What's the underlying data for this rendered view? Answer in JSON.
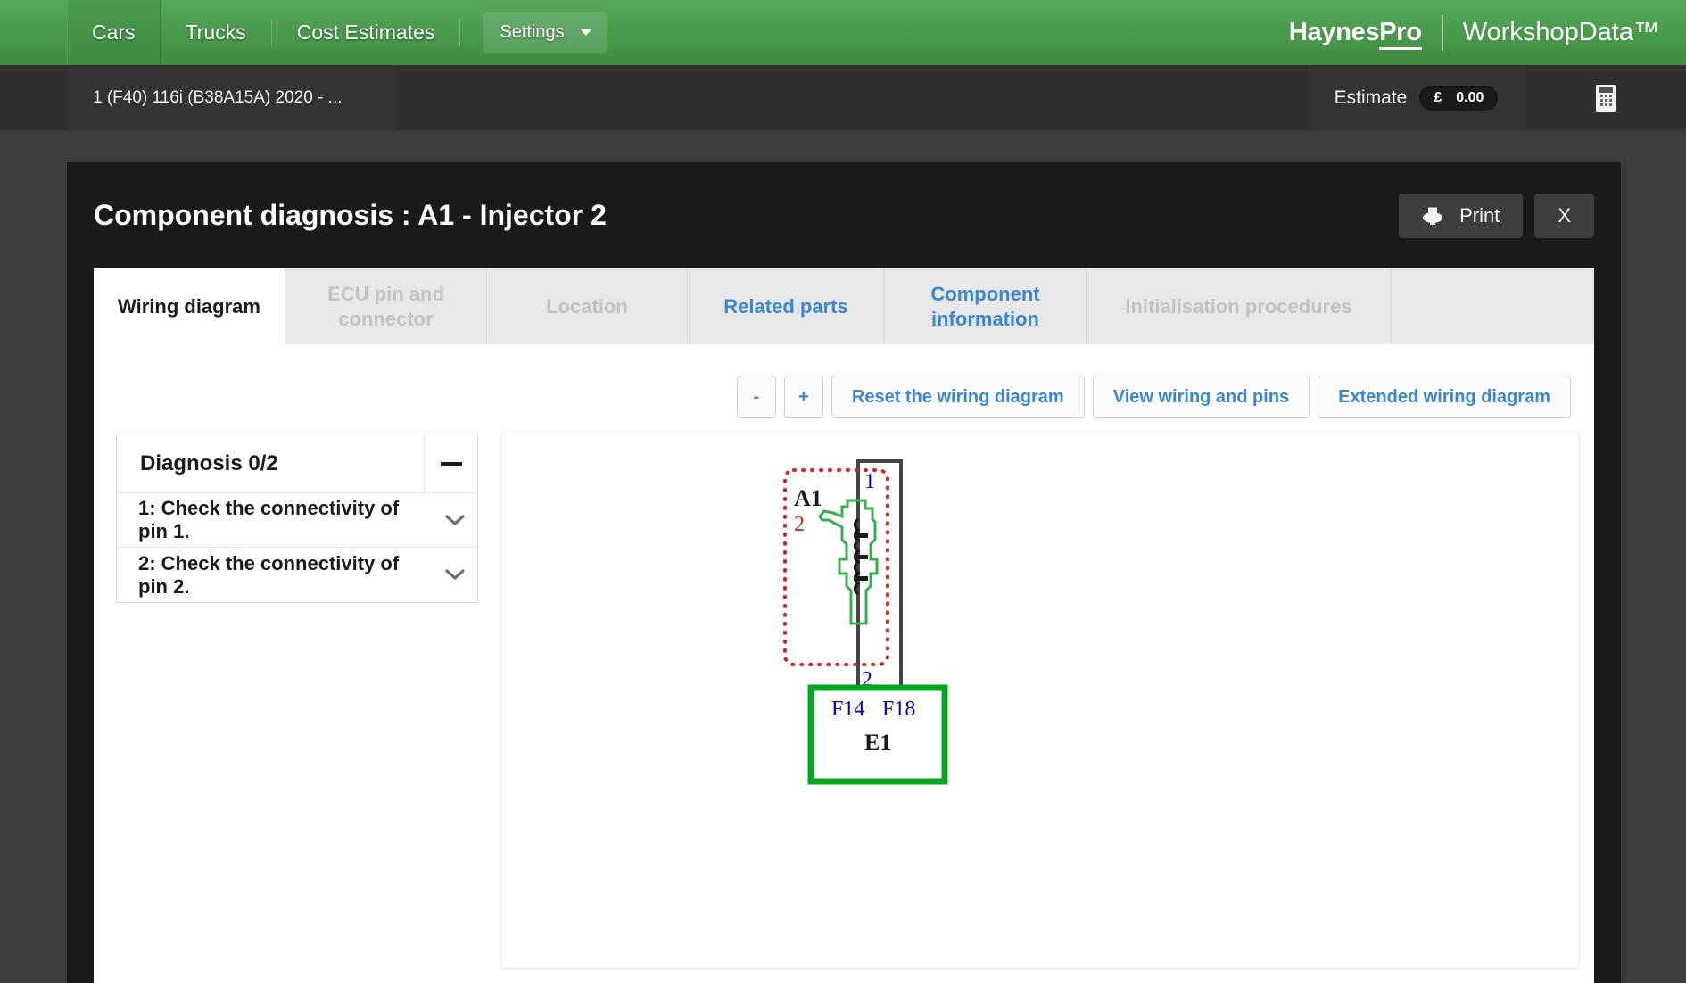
{
  "topnav": {
    "items": [
      {
        "label": "Cars",
        "active": true
      },
      {
        "label": "Trucks",
        "active": false
      },
      {
        "label": "Cost Estimates",
        "active": false
      }
    ],
    "settings_label": "Settings",
    "brand_primary": "HaynesPro",
    "brand_primary_part1": "Haynes",
    "brand_primary_part2": "Pro",
    "brand_secondary": "WorkshopData™",
    "accent_green": "#4a9a4c"
  },
  "vehicle_bar": {
    "vehicle": "1 (F40) 116i (B38A15A) 2020 - ...",
    "estimate_label": "Estimate",
    "estimate_currency": "£",
    "estimate_value": "0.00",
    "calculator_icon": "calculator-icon"
  },
  "panel": {
    "title": "Component diagnosis : A1 - Injector 2",
    "print_label": "Print",
    "close_label": "X"
  },
  "tabs": [
    {
      "label": "Wiring diagram",
      "state": "active"
    },
    {
      "label": "ECU pin and connector",
      "state": "disabled"
    },
    {
      "label": "Location",
      "state": "disabled"
    },
    {
      "label": "Related parts",
      "state": "link"
    },
    {
      "label": "Component information",
      "state": "link"
    },
    {
      "label": "Initialisation procedures",
      "state": "disabled"
    }
  ],
  "toolbar": {
    "zoom_out": "-",
    "zoom_in": "+",
    "reset": "Reset the wiring diagram",
    "view_wiring": "View wiring and pins",
    "extended": "Extended wiring diagram",
    "link_color": "#3a86d4"
  },
  "diagnosis": {
    "header": "Diagnosis 0/2",
    "collapse_icon": "minus-icon",
    "steps": [
      {
        "label": "1: Check the connectivity of pin 1."
      },
      {
        "label": "2: Check the connectivity of pin 2."
      }
    ]
  },
  "wiring_diagram": {
    "component_label": "A1",
    "component_pin_red": "2",
    "pin_top": "1",
    "pin_bottom": "2",
    "ground_box_label": "E1",
    "ground_terminals": [
      "F14",
      "F18"
    ],
    "colors": {
      "highlight_dashed": "#e02020",
      "component_outline": "#35b14a",
      "wire": "#444444",
      "ground_box": "#00a81c",
      "pin_label": "#0000cc",
      "red_label": "#e02020"
    }
  }
}
